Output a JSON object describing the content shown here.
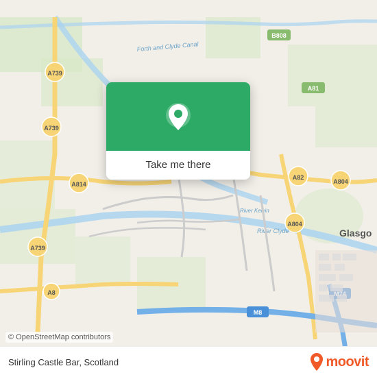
{
  "map": {
    "background_color": "#f2efe9",
    "copyright": "© OpenStreetMap contributors"
  },
  "popup": {
    "button_label": "Take me there",
    "header_color": "#2dab66"
  },
  "bottom_bar": {
    "location": "Stirling Castle Bar, Scotland",
    "moovit_label": "moovit"
  },
  "icons": {
    "pin": "📍",
    "moovit_pin_color": "#f05a28"
  }
}
